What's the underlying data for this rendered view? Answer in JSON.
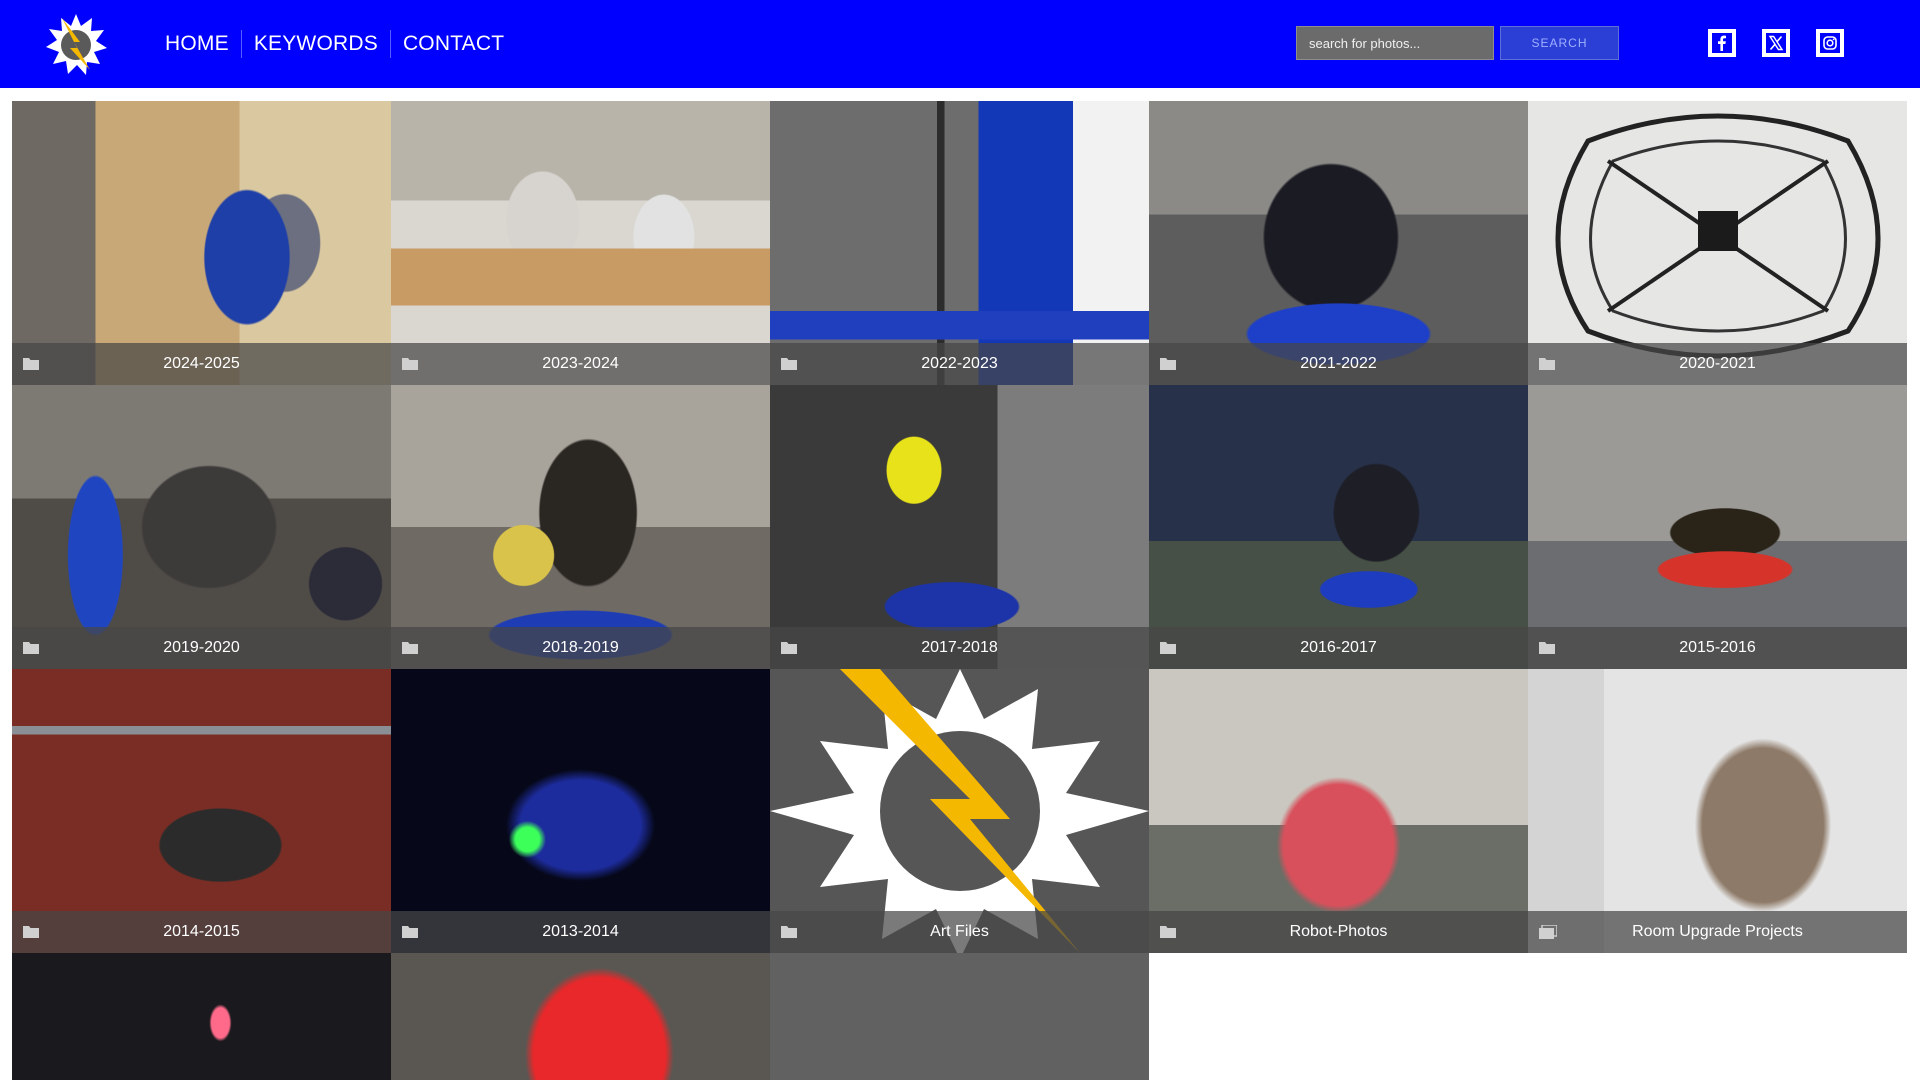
{
  "header": {
    "nav": [
      "HOME",
      "KEYWORDS",
      "CONTACT"
    ],
    "search": {
      "placeholder": "search for photos...",
      "button": "SEARCH"
    },
    "social": [
      "facebook-icon",
      "x-icon",
      "instagram-icon"
    ]
  },
  "colors": {
    "header_bg": "#0000ff",
    "caption_bg": "#464646",
    "brand_yellow": "#f5b800"
  },
  "galleries": [
    {
      "label": "2024-2025",
      "icon": "folder-icon"
    },
    {
      "label": "2023-2024",
      "icon": "folder-icon"
    },
    {
      "label": "2022-2023",
      "icon": "folder-icon"
    },
    {
      "label": "2021-2022",
      "icon": "folder-icon"
    },
    {
      "label": "2020-2021",
      "icon": "folder-icon"
    },
    {
      "label": "2019-2020",
      "icon": "folder-icon"
    },
    {
      "label": "2018-2019",
      "icon": "folder-icon"
    },
    {
      "label": "2017-2018",
      "icon": "folder-icon"
    },
    {
      "label": "2016-2017",
      "icon": "folder-icon"
    },
    {
      "label": "2015-2016",
      "icon": "folder-icon"
    },
    {
      "label": "2014-2015",
      "icon": "folder-icon"
    },
    {
      "label": "2013-2014",
      "icon": "folder-icon"
    },
    {
      "label": "Art Files",
      "icon": "folder-icon"
    },
    {
      "label": "Robot-Photos",
      "icon": "folder-icon"
    },
    {
      "label": "Room Upgrade Projects",
      "icon": "gallery-icon"
    },
    {
      "label": "",
      "icon": ""
    },
    {
      "label": "",
      "icon": ""
    },
    {
      "label": "",
      "icon": ""
    }
  ]
}
